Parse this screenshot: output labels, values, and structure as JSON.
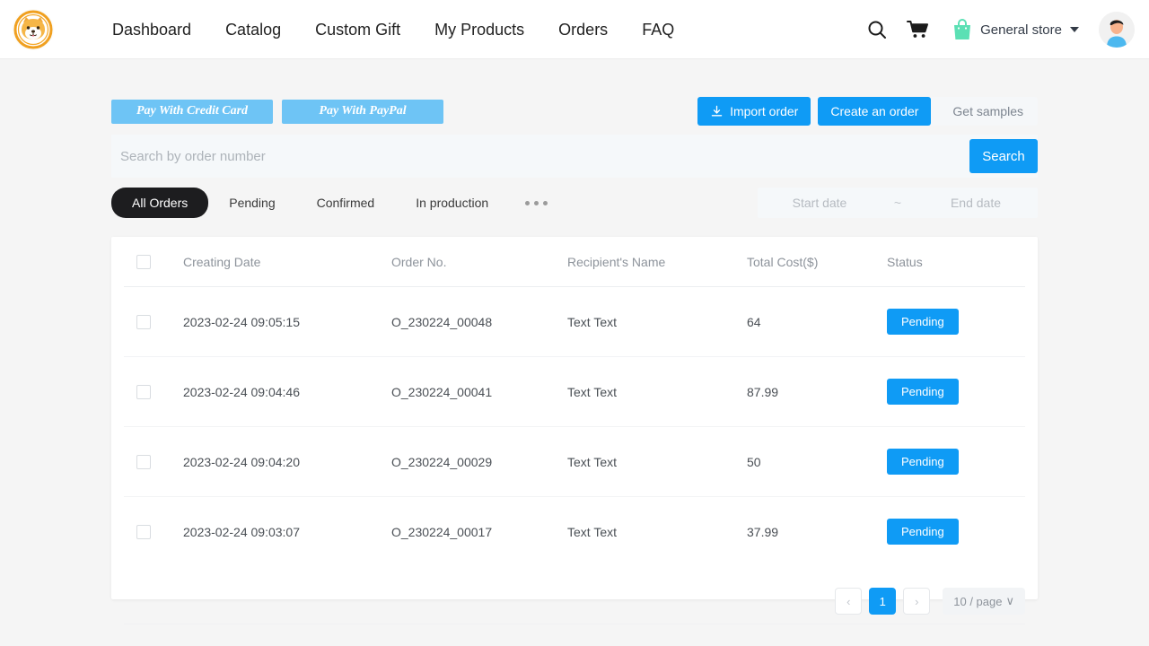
{
  "header": {
    "logo_icon": "shiba-dog-logo",
    "nav": [
      {
        "label": "Dashboard"
      },
      {
        "label": "Catalog"
      },
      {
        "label": "Custom Gift"
      },
      {
        "label": "My Products"
      },
      {
        "label": "Orders"
      },
      {
        "label": "FAQ"
      }
    ],
    "search_icon": "search-icon",
    "cart_icon": "shopping-cart-icon",
    "store_icon": "shopping-bag-icon",
    "store_name": "General store",
    "avatar_icon": "user-avatar"
  },
  "toolbar": {
    "pay_credit_card": "Pay With Credit Card",
    "pay_paypal": "Pay With PayPal",
    "import_order": "Import order",
    "import_icon": "download-icon",
    "create_order": "Create an order",
    "get_samples": "Get samples"
  },
  "search": {
    "placeholder": "Search by order number",
    "value": "",
    "button": "Search"
  },
  "filters": {
    "tabs": [
      {
        "label": "All Orders",
        "active": true
      },
      {
        "label": "Pending",
        "active": false
      },
      {
        "label": "Confirmed",
        "active": false
      },
      {
        "label": "In production",
        "active": false
      }
    ],
    "more_icon": "ellipsis-icon",
    "start_date_placeholder": "Start date",
    "start_date_value": "",
    "date_separator": "~",
    "end_date_placeholder": "End date",
    "end_date_value": ""
  },
  "table": {
    "columns": [
      "Creating Date",
      "Order No.",
      "Recipient's Name",
      "Total Cost($)",
      "Status"
    ],
    "rows": [
      {
        "date": "2023-02-24 09:05:15",
        "order_no": "O_230224_00048",
        "recipient": "Text Text",
        "cost": "64",
        "status": "Pending"
      },
      {
        "date": "2023-02-24 09:04:46",
        "order_no": "O_230224_00041",
        "recipient": "Text Text",
        "cost": "87.99",
        "status": "Pending"
      },
      {
        "date": "2023-02-24 09:04:20",
        "order_no": "O_230224_00029",
        "recipient": "Text Text",
        "cost": "50",
        "status": "Pending"
      },
      {
        "date": "2023-02-24 09:03:07",
        "order_no": "O_230224_00017",
        "recipient": "Text Text",
        "cost": "37.99",
        "status": "Pending"
      }
    ]
  },
  "pagination": {
    "prev": "‹",
    "pages": [
      "1"
    ],
    "current_page": "1",
    "next": "›",
    "page_size": "10 / page",
    "page_size_caret": "∨"
  },
  "colors": {
    "accent_blue": "#0f9bf5",
    "pay_button_blue": "#6ec4f5",
    "tab_active_dark": "#1d1d1f",
    "page_background": "#f5f5f5",
    "logo_gold": "#f0a020"
  }
}
